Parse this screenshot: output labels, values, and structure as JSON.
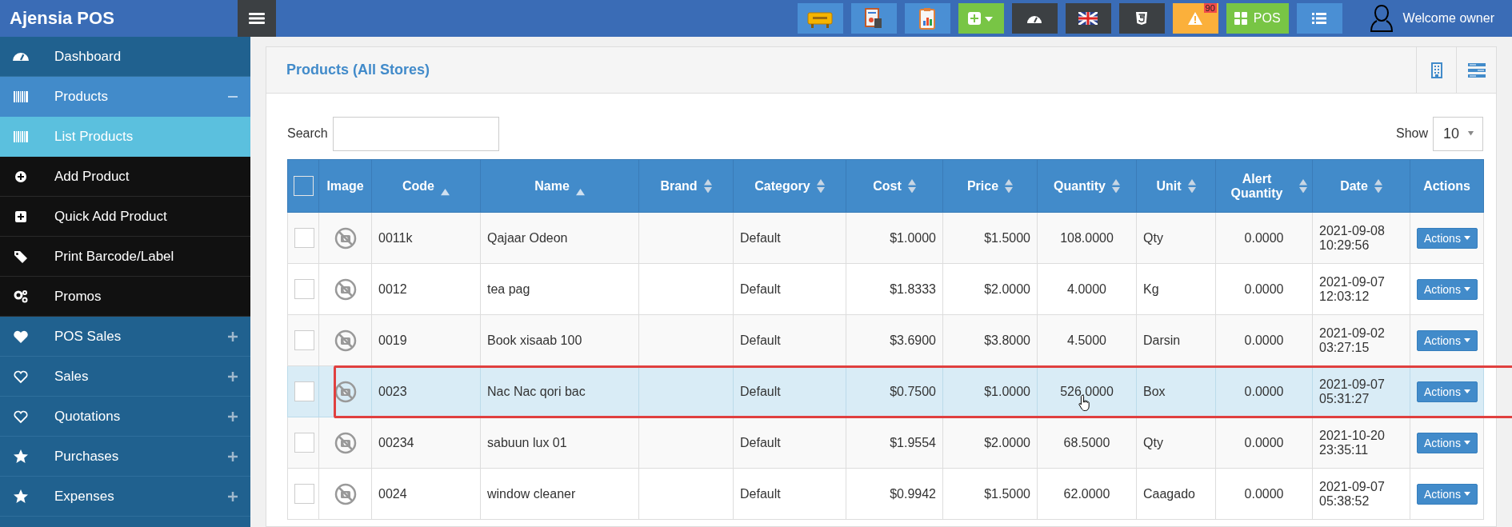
{
  "app": {
    "brand": "Ajensia POS"
  },
  "toolbar": [
    {
      "kind": "welcome",
      "color": "#4a8fd4"
    },
    {
      "kind": "report",
      "color": "#4a8fd4"
    },
    {
      "kind": "clipboard",
      "color": "#4a8fd4"
    },
    {
      "kind": "add",
      "color": "#78c545"
    },
    {
      "kind": "dashboard",
      "color": "#3c4043"
    },
    {
      "kind": "flag",
      "color": "#3c4043"
    },
    {
      "kind": "html5",
      "color": "#3c4043"
    },
    {
      "kind": "alert",
      "color": "#fbb03b",
      "badge": "90"
    },
    {
      "kind": "pos",
      "color": "#78c545",
      "label": "POS"
    },
    {
      "kind": "list",
      "color": "#4a8fd4"
    }
  ],
  "user": {
    "greeting": "Welcome owner"
  },
  "sidebar": {
    "items": [
      {
        "label": "Dashboard",
        "kind": "dashboard",
        "selected": false
      },
      {
        "label": "Products",
        "kind": "barcode",
        "selected": false,
        "expanded": true,
        "children": [
          {
            "label": "List Products",
            "kind": "barcode",
            "selected": true
          },
          {
            "label": "Add Product",
            "kind": "plus-circle",
            "selected": false
          },
          {
            "label": "Quick Add Product",
            "kind": "plus-square",
            "selected": false
          },
          {
            "label": "Print Barcode/Label",
            "kind": "tags",
            "selected": false
          },
          {
            "label": "Promos",
            "kind": "gears",
            "selected": false
          }
        ]
      },
      {
        "label": "POS Sales",
        "kind": "heart",
        "selected": false,
        "expanded": false
      },
      {
        "label": "Sales",
        "kind": "heart-outline",
        "selected": false,
        "expanded": false
      },
      {
        "label": "Quotations",
        "kind": "heart-outline",
        "selected": false,
        "expanded": false
      },
      {
        "label": "Purchases",
        "kind": "star",
        "selected": false,
        "expanded": false
      },
      {
        "label": "Expenses",
        "kind": "star",
        "selected": false,
        "expanded": false
      }
    ]
  },
  "panel": {
    "title": "Products (All Stores)",
    "search": {
      "label": "Search"
    },
    "page_size": {
      "label": "Show",
      "value": "10"
    },
    "table": {
      "select_all": {
        "checked": false
      },
      "columns": [
        {
          "label": "Image",
          "sortable": false
        },
        {
          "label": "Code",
          "sortable": true,
          "sorted": true
        },
        {
          "label": "Name",
          "sortable": true,
          "sorted": true
        },
        {
          "label": "Brand",
          "sortable": true,
          "sorted": false
        },
        {
          "label": "Category",
          "sortable": true,
          "sorted": false
        },
        {
          "label": "Cost",
          "sortable": true,
          "sorted": false
        },
        {
          "label": "Price",
          "sortable": true,
          "sorted": false
        },
        {
          "label": "Quantity",
          "sortable": true,
          "sorted": false
        },
        {
          "label": "Unit",
          "sortable": true,
          "sorted": false
        },
        {
          "label": "Alert Quantity",
          "sortable": true,
          "sorted": false
        },
        {
          "label": "Date",
          "sortable": true,
          "sorted": false
        },
        {
          "label": "Actions",
          "sortable": false
        }
      ],
      "rows": [
        {
          "checked": false,
          "highlighted": false,
          "code": "0011k",
          "name": "Qajaar Odeon",
          "category": "Default",
          "cost": "$1.0000",
          "price": "$1.5000",
          "quantity": "108.0000",
          "unit": "Qty",
          "alert_quantity": "0.0000",
          "date": "2021-09-08 10:29:56",
          "action": "Actions"
        },
        {
          "checked": false,
          "highlighted": false,
          "code": "0012",
          "name": "tea pag",
          "category": "Default",
          "cost": "$1.8333",
          "price": "$2.0000",
          "quantity": "4.0000",
          "unit": "Kg",
          "alert_quantity": "0.0000",
          "date": "2021-09-07 12:03:12",
          "action": "Actions"
        },
        {
          "checked": false,
          "highlighted": false,
          "code": "0019",
          "name": "Book xisaab 100",
          "category": "Default",
          "cost": "$3.6900",
          "price": "$3.8000",
          "quantity": "4.5000",
          "unit": "Darsin",
          "alert_quantity": "0.0000",
          "date": "2021-09-02 03:27:15",
          "action": "Actions"
        },
        {
          "checked": false,
          "highlighted": true,
          "code": "0023",
          "name": "Nac Nac qori bac",
          "category": "Default",
          "cost": "$0.7500",
          "price": "$1.0000",
          "quantity": "526.0000",
          "unit": "Box",
          "alert_quantity": "0.0000",
          "date": "2021-09-07 05:31:27",
          "action": "Actions"
        },
        {
          "checked": false,
          "highlighted": false,
          "code": "00234",
          "name": "sabuun lux 01",
          "category": "Default",
          "cost": "$1.9554",
          "price": "$2.0000",
          "quantity": "68.5000",
          "unit": "Qty",
          "alert_quantity": "0.0000",
          "date": "2021-10-20 23:35:11",
          "action": "Actions"
        },
        {
          "checked": false,
          "highlighted": false,
          "code": "0024",
          "name": "window cleaner",
          "category": "Default",
          "cost": "$0.9942",
          "price": "$1.5000",
          "quantity": "62.0000",
          "unit": "Caagado",
          "alert_quantity": "0.0000",
          "date": "2021-09-07 05:38:52",
          "action": "Actions"
        }
      ]
    }
  }
}
